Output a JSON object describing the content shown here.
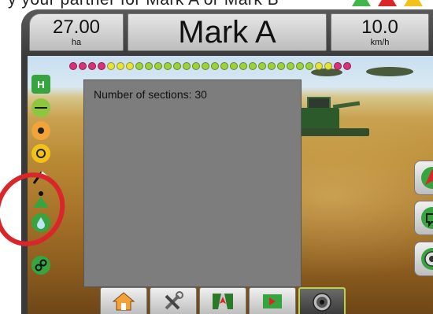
{
  "header": {
    "area_value": "27.00",
    "area_unit": "ha",
    "title": "Mark A",
    "speed_value": "10.0",
    "speed_unit": "km/h"
  },
  "top_fragment": "y your partner for Mark A or Mark B",
  "info_panel": {
    "text": "Number of sections: 30"
  },
  "section_count": 30,
  "colors": {
    "section_red": "#d9307a",
    "section_green": "#9bd23a",
    "section_yellow": "#e3e33a",
    "highlight_red": "#d9262b",
    "active_tab_border": "#b7d34a"
  },
  "left_icons": [
    "boom-icon",
    "steering-icon",
    "camera-icon",
    "tilt-icon",
    "gps-signal-icon",
    "mark-icon",
    "product-drop-icon",
    "link-icon"
  ],
  "right_buttons": [
    "guidance-view-button",
    "map-view-button",
    "rtk-view-button"
  ],
  "tabs": [
    "home-tab",
    "tools-tab",
    "guidance-tab",
    "field-tab",
    "camera-tab"
  ]
}
